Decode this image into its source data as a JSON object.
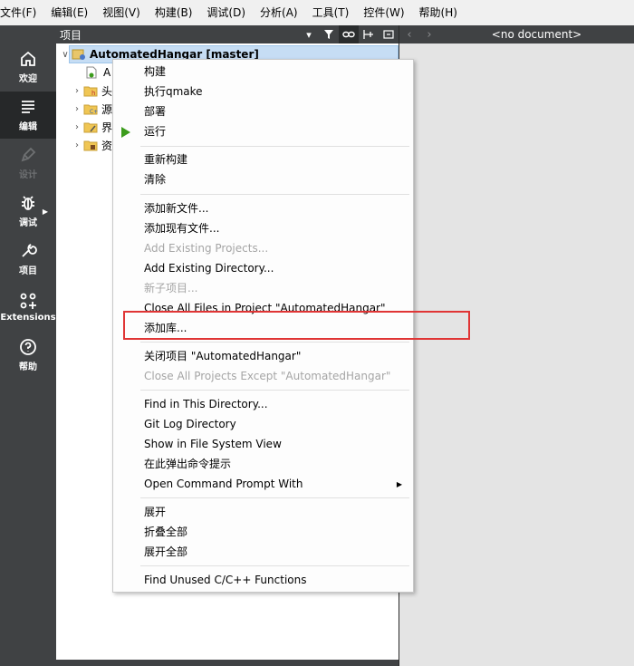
{
  "menubar": [
    "文件(F)",
    "编辑(E)",
    "视图(V)",
    "构建(B)",
    "调试(D)",
    "分析(A)",
    "工具(T)",
    "控件(W)",
    "帮助(H)"
  ],
  "modes": {
    "welcome": "欢迎",
    "edit": "编辑",
    "design": "设计",
    "debug": "调试",
    "projects": "项目",
    "extensions": "Extensions",
    "help": "帮助"
  },
  "project_pane": {
    "title": "项目",
    "root": "AutomatedHangar [master]",
    "children": [
      "A",
      "头",
      "源",
      "界",
      "资"
    ]
  },
  "editor": {
    "back": "‹",
    "forward": "›",
    "no_document": "<no document>"
  },
  "context_menu": {
    "build": "构建",
    "run_qmake": "执行qmake",
    "deploy": "部署",
    "run": "运行",
    "rebuild": "重新构建",
    "clean": "清除",
    "add_new_file": "添加新文件...",
    "add_existing_files": "添加现有文件...",
    "add_existing_projects": "Add Existing Projects...",
    "add_existing_directory": "Add Existing Directory...",
    "new_subproject": "新子项目...",
    "close_all_files": "Close All Files in Project \"AutomatedHangar\"",
    "add_library": "添加库...",
    "close_project": "关闭项目 \"AutomatedHangar\"",
    "close_all_except": "Close All Projects Except \"AutomatedHangar\"",
    "find_in_directory": "Find in This Directory...",
    "git_log_directory": "Git Log Directory",
    "show_in_file_system": "Show in File System View",
    "open_terminal": "在此弹出命令提示",
    "open_cmd_with": "Open Command Prompt With",
    "expand": "展开",
    "collapse_all": "折叠全部",
    "expand_all": "展开全部",
    "find_unused": "Find Unused C/C++ Functions"
  },
  "colors": {
    "run_green": "#3c9c1c",
    "highlight_red": "#e03535",
    "selection_blue": "#c6ddf4"
  }
}
